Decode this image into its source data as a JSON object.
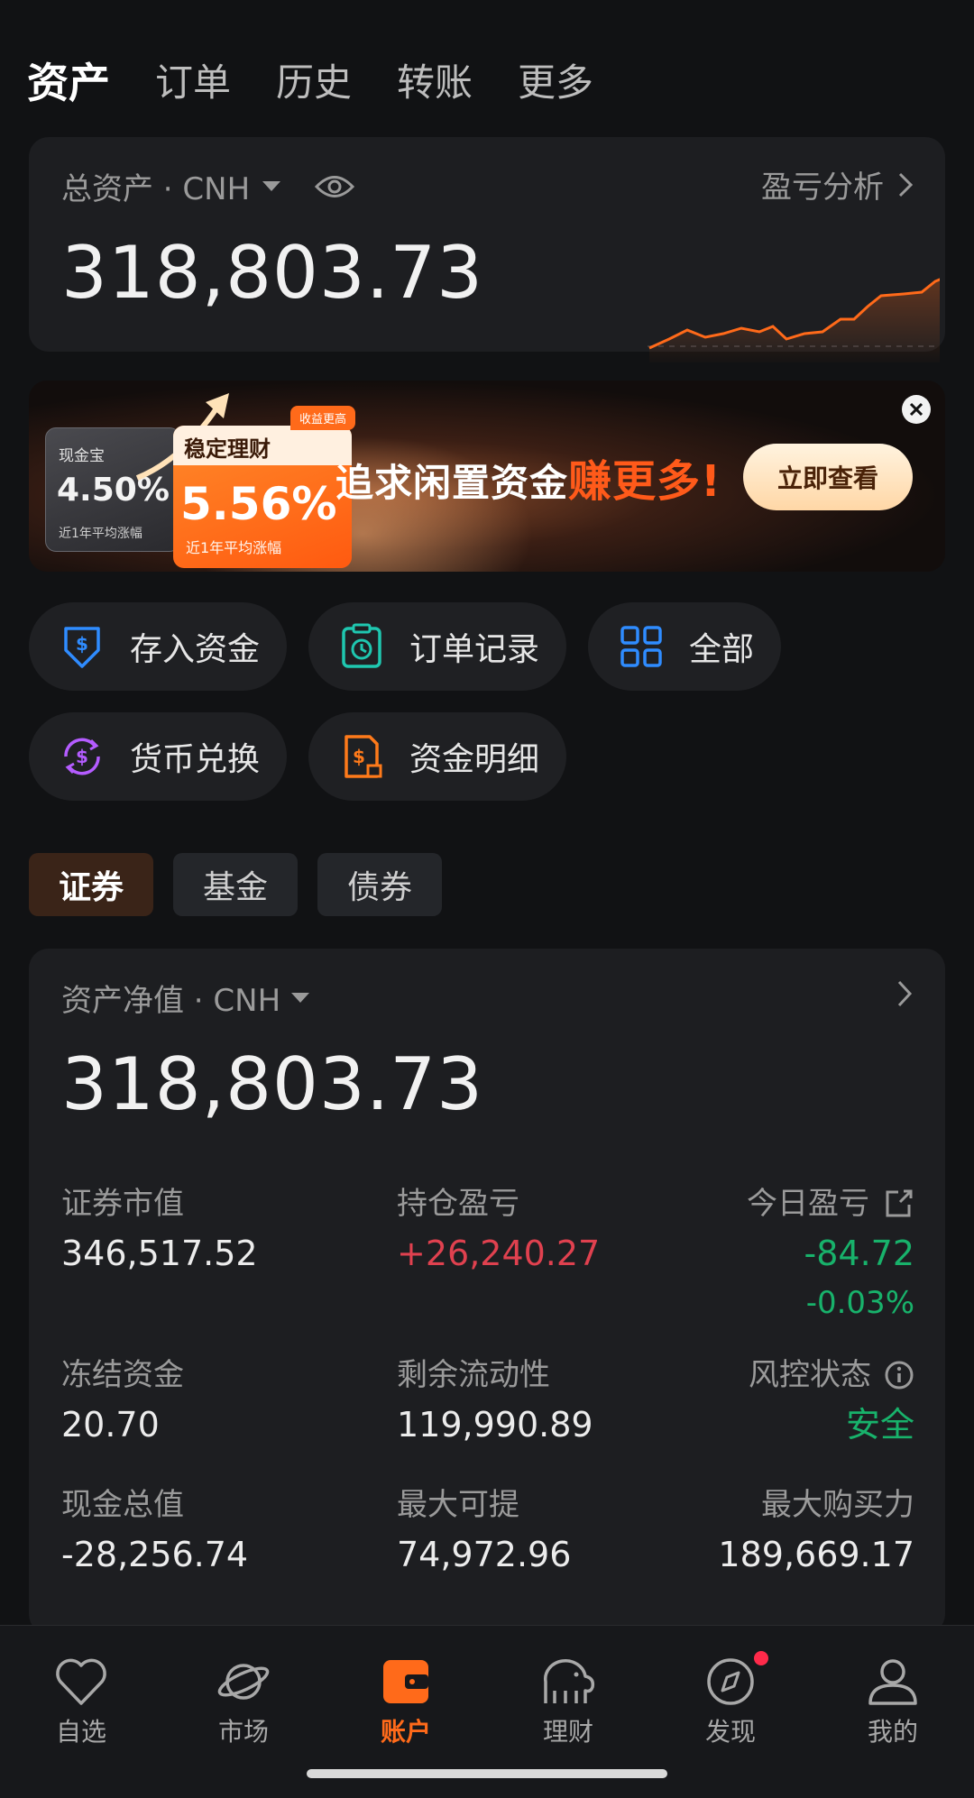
{
  "top_tabs": [
    "资产",
    "订单",
    "历史",
    "转账",
    "更多"
  ],
  "total_assets": {
    "label": "总资产 · CNH",
    "value": "318,803.73",
    "pnl_link": "盈亏分析"
  },
  "banner": {
    "mini_title": "现金宝",
    "mini_rate": "4.50%",
    "mini_sub": "近1年平均涨幅",
    "big_title": "稳定理财",
    "big_tag": "收益更高",
    "big_rate": "5.56%",
    "big_sub": "近1年平均涨幅",
    "slogan_main": "追求闲置资金",
    "slogan_highlight": "赚更多!",
    "cta": "立即查看"
  },
  "actions": [
    {
      "label": "存入资金",
      "icon": "deposit-icon",
      "color": "#2f8cff"
    },
    {
      "label": "订单记录",
      "icon": "clipboard-clock-icon",
      "color": "#1fc7b0"
    },
    {
      "label": "全部",
      "icon": "grid-icon",
      "color": "#2f8cff"
    },
    {
      "label": "货币兑换",
      "icon": "currency-exchange-icon",
      "color": "#b45cff"
    },
    {
      "label": "资金明细",
      "icon": "fund-detail-icon",
      "color": "#ff7a1a"
    }
  ],
  "segments": [
    "证券",
    "基金",
    "债券"
  ],
  "net_asset": {
    "label": "资产净值 · CNH",
    "value": "318,803.73",
    "metrics": {
      "securities_value": {
        "label": "证券市值",
        "value": "346,517.52"
      },
      "position_pnl": {
        "label": "持仓盈亏",
        "value": "+26,240.27"
      },
      "today_pnl": {
        "label": "今日盈亏",
        "value": "-84.72",
        "pct": "-0.03%"
      },
      "frozen_funds": {
        "label": "冻结资金",
        "value": "20.70"
      },
      "remaining_liquidity": {
        "label": "剩余流动性",
        "value": "119,990.89"
      },
      "risk_status": {
        "label": "风控状态",
        "value": "安全"
      },
      "total_cash": {
        "label": "现金总值",
        "value": "-28,256.74"
      },
      "max_withdrawable": {
        "label": "最大可提",
        "value": "74,972.96"
      },
      "max_buying_power": {
        "label": "最大购买力",
        "value": "189,669.17"
      }
    }
  },
  "bottom_nav": [
    {
      "label": "自选",
      "icon": "heart-icon"
    },
    {
      "label": "市场",
      "icon": "planet-icon"
    },
    {
      "label": "账户",
      "icon": "wallet-icon"
    },
    {
      "label": "理财",
      "icon": "elephant-icon"
    },
    {
      "label": "发现",
      "icon": "compass-icon"
    },
    {
      "label": "我的",
      "icon": "user-icon"
    }
  ],
  "colors": {
    "accent": "#ff6a1a",
    "up": "#e0414f",
    "down": "#18b26b",
    "background": "#111214",
    "card": "#1d1e21"
  }
}
